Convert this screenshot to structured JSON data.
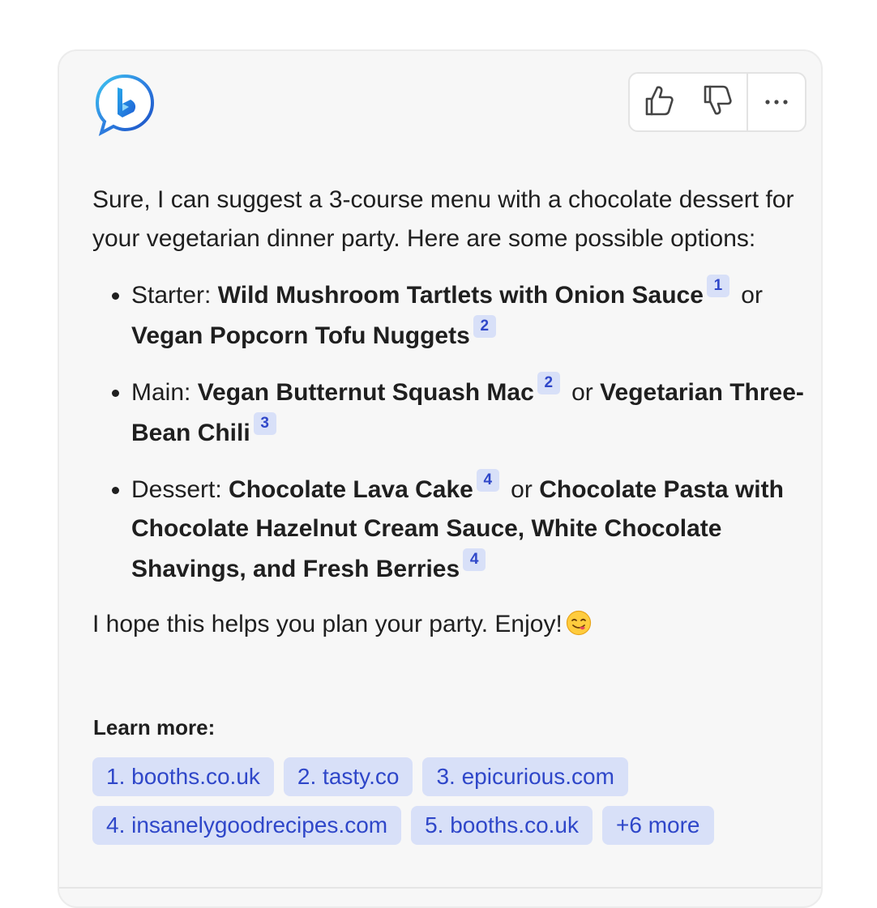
{
  "message": {
    "intro": "Sure, I can suggest a 3-course menu with a chocolate dessert for your vegetarian dinner party. Here are some possible options:",
    "items": [
      {
        "label": "Starter: ",
        "option1": "Wild Mushroom Tartlets with Onion Sauce",
        "cite1": "1",
        "or": "or",
        "option2": "Vegan Popcorn Tofu Nuggets",
        "cite2": "2"
      },
      {
        "label": "Main: ",
        "option1": "Vegan Butternut Squash Mac",
        "cite1": "2",
        "or": "or",
        "option2": "Vegetarian Three-Bean Chili",
        "cite2": "3"
      },
      {
        "label": "Dessert: ",
        "option1": "Chocolate Lava Cake",
        "cite1": "4",
        "or": "or",
        "option2": "Chocolate Pasta with Chocolate Hazelnut Cream Sauce, White Chocolate Shavings, and Fresh Berries",
        "cite2": "4"
      }
    ],
    "closing": "I hope this helps you plan your party. Enjoy!",
    "closing_emoji": "smiling-face-savoring-food-emoji"
  },
  "learn_more": {
    "title": "Learn more:",
    "links": [
      "1. booths.co.uk",
      "2. tasty.co",
      "3. epicurious.com",
      "4. insanelygoodrecipes.com",
      "5. booths.co.uk",
      "+6 more"
    ]
  },
  "icons": {
    "logo": "bing-chat-logo",
    "like": "thumbs-up-icon",
    "dislike": "thumbs-down-icon",
    "more": "more-options-icon"
  },
  "colors": {
    "card_background": "#f7f7f7",
    "citation_chip": "#d8e0f8",
    "link_text": "#2f47c9"
  }
}
